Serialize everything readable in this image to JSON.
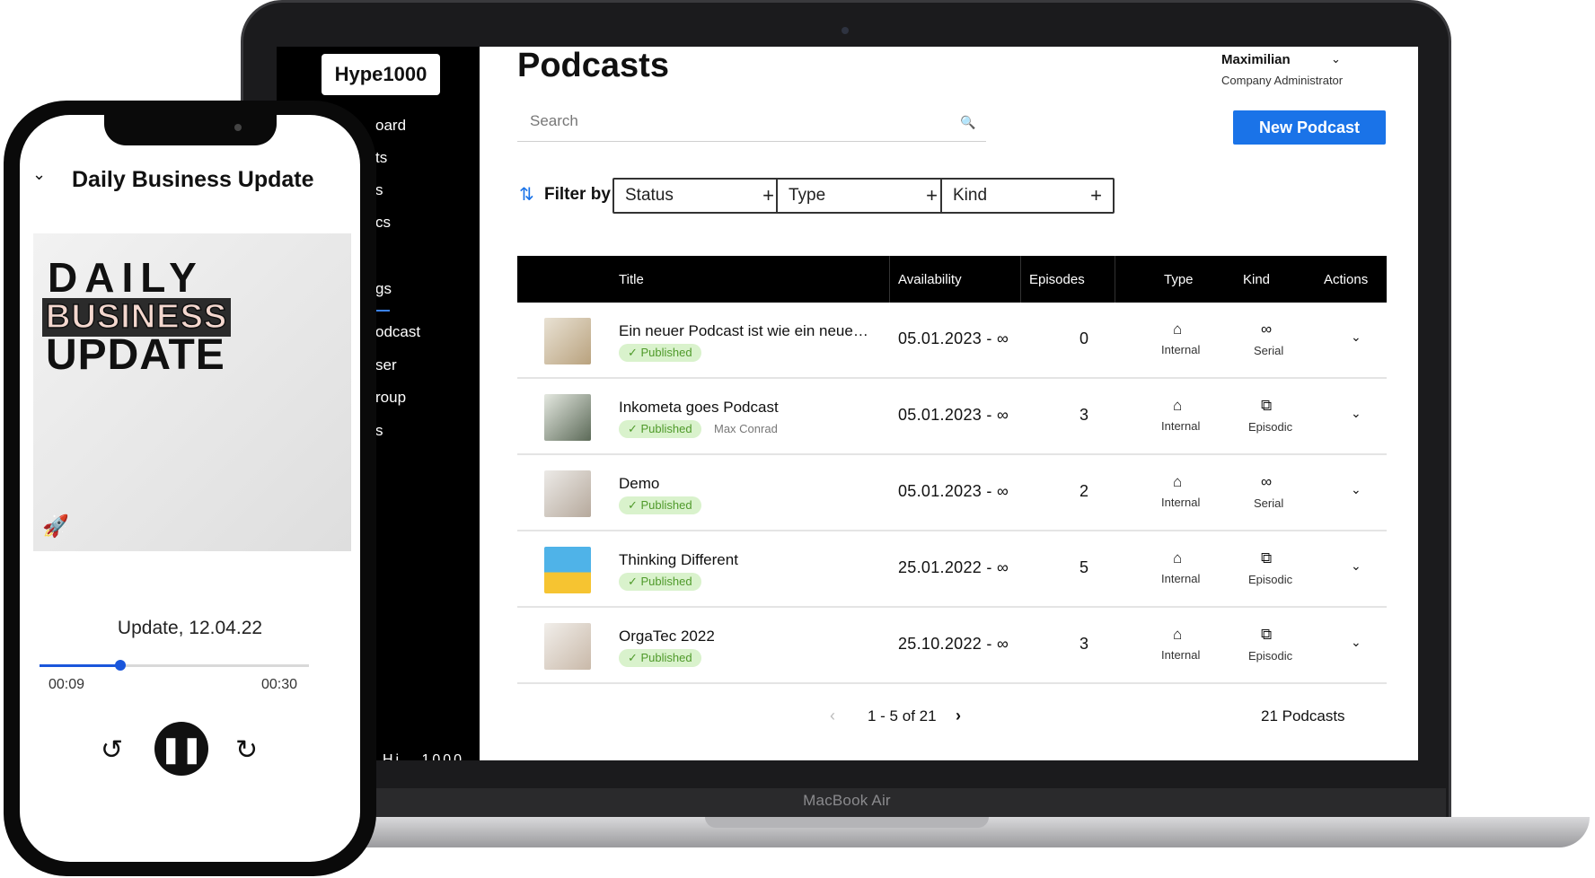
{
  "laptop": {
    "label": "MacBook Air"
  },
  "app": {
    "logo": "Hype1000",
    "sidebar": {
      "items": [
        "oard",
        "ts",
        "s",
        "cs",
        "gs",
        "odcast",
        "ser",
        "roup",
        "s"
      ],
      "bottom": "Hi . 1000"
    },
    "page_title": "Podcasts",
    "user": {
      "name": "Maximilian",
      "role": "Company Administrator"
    },
    "search": {
      "placeholder": "Search"
    },
    "new_button": "New Podcast",
    "filter": {
      "label": "Filter by",
      "boxes": [
        "Status",
        "Type",
        "Kind"
      ],
      "plus": "+"
    },
    "table": {
      "headers": {
        "title": "Title",
        "availability": "Availability",
        "episodes": "Episodes",
        "type": "Type",
        "kind": "Kind",
        "actions": "Actions"
      },
      "rows": [
        {
          "title": "Ein neuer Podcast ist wie ein neues ...",
          "status": "✓ Published",
          "author": "",
          "availability": "05.01.2023 - ∞",
          "episodes": "0",
          "type": "Internal",
          "kind": "Serial",
          "kind_icon": "∞"
        },
        {
          "title": "Inkometa goes Podcast",
          "status": "✓ Published",
          "author": "Max Conrad",
          "availability": "05.01.2023 - ∞",
          "episodes": "3",
          "type": "Internal",
          "kind": "Episodic",
          "kind_icon": "⧉"
        },
        {
          "title": "Demo",
          "status": "✓ Published",
          "author": "",
          "availability": "05.01.2023 - ∞",
          "episodes": "2",
          "type": "Internal",
          "kind": "Serial",
          "kind_icon": "∞"
        },
        {
          "title": "Thinking Different",
          "status": "✓ Published",
          "author": "",
          "availability": "25.01.2022 - ∞",
          "episodes": "5",
          "type": "Internal",
          "kind": "Episodic",
          "kind_icon": "⧉"
        },
        {
          "title": "OrgaTec 2022",
          "status": "✓ Published",
          "author": "",
          "availability": "25.10.2022 - ∞",
          "episodes": "3",
          "type": "Internal",
          "kind": "Episodic",
          "kind_icon": "⧉"
        }
      ]
    },
    "pagination": {
      "range": "1 - 5 of 21",
      "total": "21 Podcasts"
    }
  },
  "phone": {
    "title": "Daily Business Update",
    "cover": {
      "line1": "DAILY",
      "line2": "BUSINESS",
      "line3": "UPDATE"
    },
    "episode": "Update, 12.04.22",
    "current_time": "00:09",
    "duration": "00:30",
    "progress": 0.3
  },
  "colors": {
    "accent": "#1a73e8",
    "published_bg": "#d9f2cc",
    "published_text": "#4f9a2a"
  }
}
